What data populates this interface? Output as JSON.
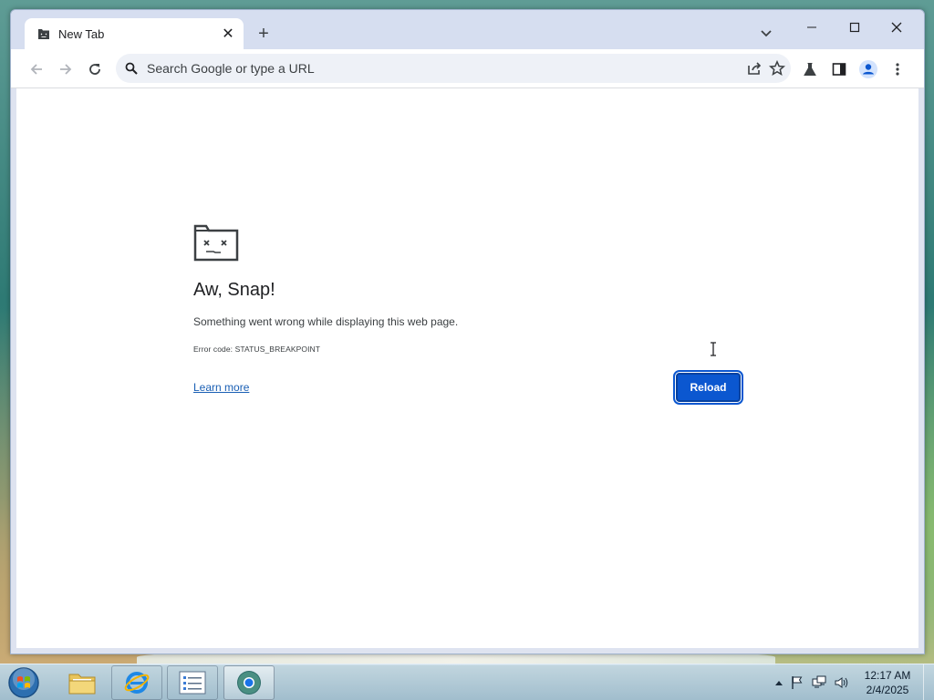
{
  "browser": {
    "tab": {
      "title": "New Tab",
      "close_label": "✕"
    },
    "new_tab_label": "+",
    "omnibox": {
      "placeholder": "Search Google or type a URL",
      "value": ""
    }
  },
  "error_page": {
    "heading": "Aw, Snap!",
    "message": "Something went wrong while displaying this web page.",
    "error_code": "Error code: STATUS_BREAKPOINT",
    "learn_more": "Learn more",
    "reload": "Reload"
  },
  "taskbar": {
    "time": "12:17 AM",
    "date": "2/4/2025"
  },
  "colors": {
    "accent": "#0b57d0",
    "link": "#1a5fb4",
    "tabstrip": "#d6def0"
  },
  "icons": {
    "tab_favicon": "sad-tab-icon",
    "back": "arrow-left-icon",
    "forward": "arrow-right-icon",
    "reload": "reload-icon",
    "search": "search-icon",
    "share": "share-icon",
    "bookmark": "star-icon",
    "labs": "flask-icon",
    "side_panel": "side-panel-icon",
    "profile": "profile-icon",
    "menu": "kebab-menu-icon"
  }
}
